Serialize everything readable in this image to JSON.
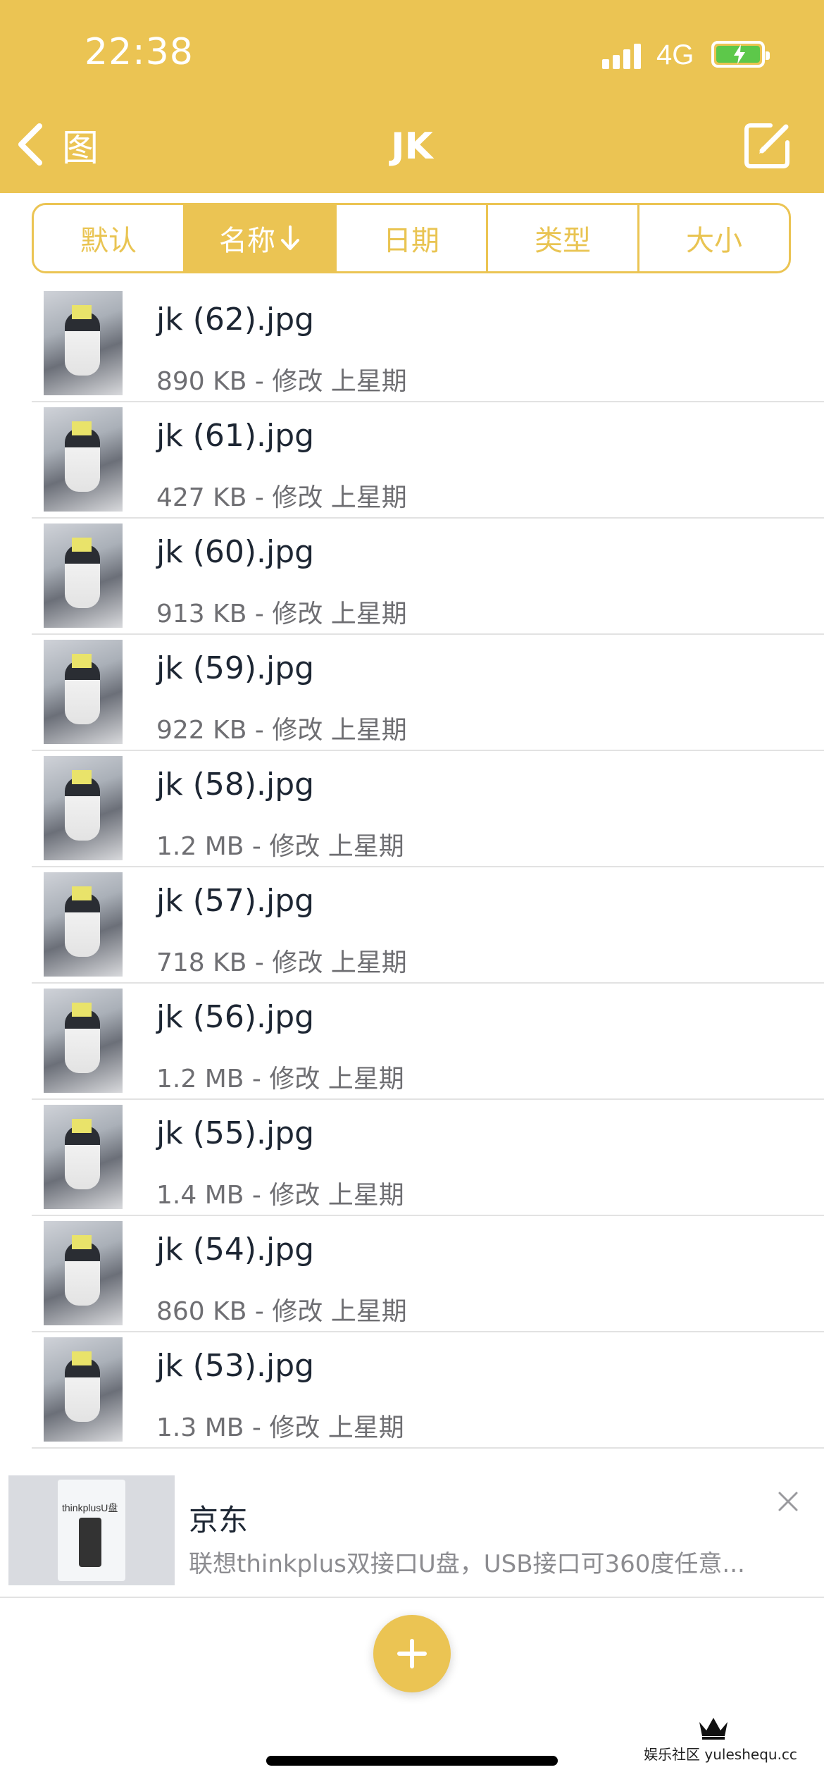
{
  "status_bar": {
    "time": "22:38",
    "network": "4G"
  },
  "nav": {
    "back_label": "图",
    "title": "JK"
  },
  "sort": {
    "options": [
      "默认",
      "名称",
      "日期",
      "类型",
      "大小"
    ],
    "active": "名称"
  },
  "files": [
    {
      "name": "jk (62).jpg",
      "meta": "890 KB - 修改 上星期"
    },
    {
      "name": "jk (61).jpg",
      "meta": "427 KB - 修改 上星期"
    },
    {
      "name": "jk (60).jpg",
      "meta": "913 KB - 修改 上星期"
    },
    {
      "name": "jk (59).jpg",
      "meta": "922 KB - 修改 上星期"
    },
    {
      "name": "jk (58).jpg",
      "meta": "1.2 MB - 修改 上星期"
    },
    {
      "name": "jk (57).jpg",
      "meta": "718 KB - 修改 上星期"
    },
    {
      "name": "jk (56).jpg",
      "meta": "1.2 MB - 修改 上星期"
    },
    {
      "name": "jk (55).jpg",
      "meta": "1.4 MB - 修改 上星期"
    },
    {
      "name": "jk (54).jpg",
      "meta": "860 KB - 修改 上星期"
    },
    {
      "name": "jk (53).jpg",
      "meta": "1.3 MB - 修改 上星期"
    }
  ],
  "ad": {
    "brand": "京东",
    "description": "联想thinkplus双接口U盘，USB接口可360度任意...",
    "image_text": "thinkplusU盘"
  },
  "watermark": {
    "text": "娱乐社区 yuleshequ.cc"
  },
  "colors": {
    "accent": "#ebc453",
    "text": "#1d2633",
    "meta": "#6e6e72"
  }
}
